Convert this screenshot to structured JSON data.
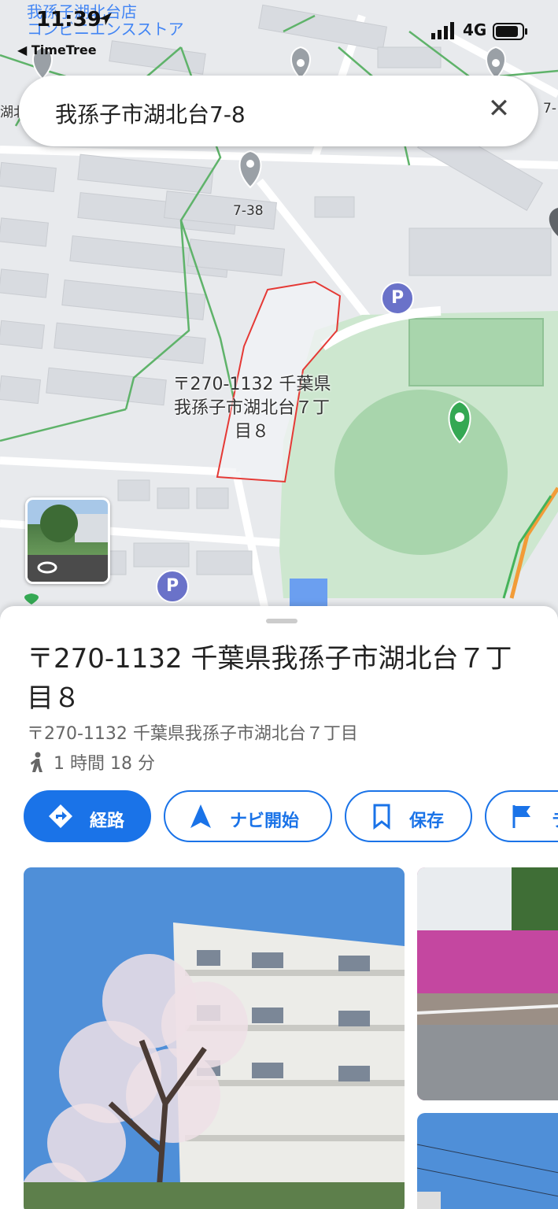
{
  "status": {
    "time": "11:39",
    "back_app": "◀ TimeTree",
    "network": "4G"
  },
  "map": {
    "shop_name": "我孫子湖北台店",
    "shop_type": "コンビニエンスストア",
    "edge_label_left": "湖北",
    "edge_label_right": "7-",
    "pin_label": "7-38",
    "address_label_line1": "〒270-1132 千葉県",
    "address_label_line2": "我孫子市湖北台７丁",
    "address_label_line3": "目８",
    "parking_symbol": "P"
  },
  "search": {
    "query": "我孫子市湖北台7-8",
    "clear_icon": "close-icon"
  },
  "place": {
    "title": "〒270-1132 千葉県我孫子市湖北台７丁目８",
    "address": "〒270-1132 千葉県我孫子市湖北台７丁目",
    "travel_time": "1 時間 18 分"
  },
  "actions": {
    "directions": "経路",
    "navigate": "ナビ開始",
    "save": "保存",
    "more": "ラ"
  },
  "colors": {
    "accent": "#1a73e8",
    "boundary": "#e53935",
    "park": "#cde7cf"
  }
}
